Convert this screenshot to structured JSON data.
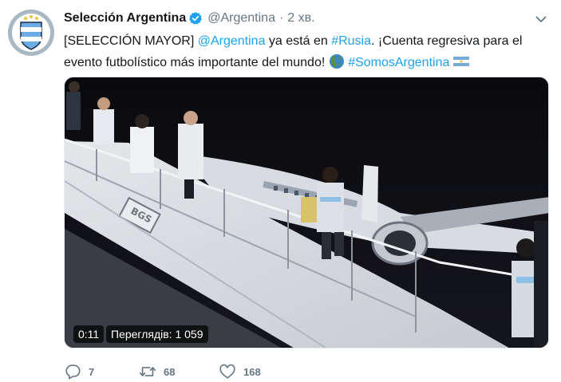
{
  "tweet": {
    "author": {
      "display_name": "Selección Argentina",
      "handle": "@Argentina",
      "verified": true,
      "avatar_icon": "afa-crest-icon"
    },
    "separator": "·",
    "time": "2 хв.",
    "text": {
      "prefix": "[SELECCIÓN MAYOR] ",
      "mention": "@Argentina",
      "part2": " ya está en ",
      "hashtag1": "#Rusia",
      "part3": ". ¡Cuenta regresiva para el evento futbolístico más importante del mundo! ",
      "emoji_globe": "globe-americas-emoji",
      "hashtag2": "#SomosArgentina",
      "emoji_flag": "argentina-flag-emoji"
    },
    "media": {
      "kind": "video",
      "duration": "0:11",
      "views": "Переглядів: 1 059"
    },
    "actions": {
      "replies": "7",
      "retweets": "68",
      "likes": "168"
    },
    "colors": {
      "link": "#1da1f2",
      "muted": "#657786",
      "verified": "#1da1f2"
    }
  }
}
